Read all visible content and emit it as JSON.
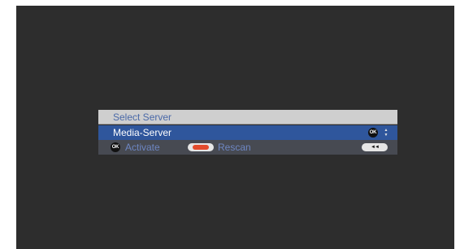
{
  "dialog": {
    "title": "Select Server",
    "selected_server": "Media-Server",
    "footer": {
      "activate_label": "Activate",
      "rescan_label": "Rescan",
      "ok_icon_text": "OK",
      "back_icon_text": "◄◄",
      "updown_icon_text": "▲▼"
    }
  },
  "colors": {
    "screen_bg": "#2d2d2d",
    "title_bg": "#cfcfcf",
    "title_text": "#4a69a8",
    "selected_row_bg": "#2f569c",
    "footer_bg": "#474a52",
    "footer_text": "#6d86c2",
    "rescan_red": "#e34b2c"
  },
  "icons": [
    "ok-icon",
    "up-down-arrows-icon",
    "red-button-icon",
    "rewind-back-icon"
  ]
}
